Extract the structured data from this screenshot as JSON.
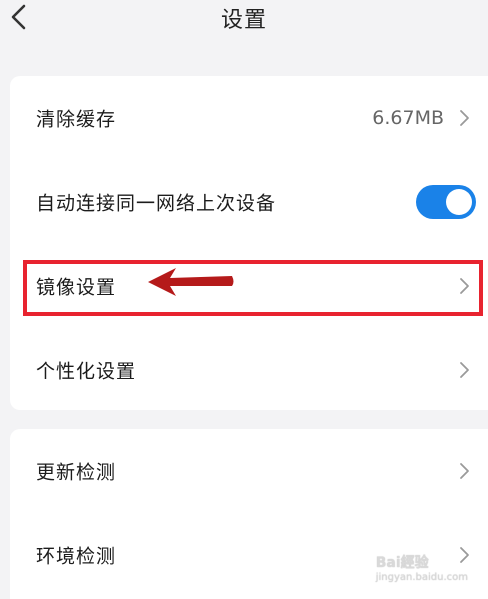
{
  "header": {
    "title": "设置"
  },
  "settings_group_1": {
    "items": [
      {
        "label": "清除缓存",
        "value": "6.67MB"
      },
      {
        "label": "自动连接同一网络上次设备",
        "toggle_on": true
      },
      {
        "label": "镜像设置"
      },
      {
        "label": "个性化设置"
      }
    ]
  },
  "settings_group_2": {
    "items": [
      {
        "label": "更新检测"
      },
      {
        "label": "环境检测"
      }
    ]
  },
  "annotation": {
    "highlight_color": "#e8232f",
    "arrow_color": "#b51a1a"
  },
  "watermark": {
    "text": "Bai經验",
    "sub": "jingyan.baidu.com"
  },
  "colors": {
    "accent": "#1a82e8",
    "background": "#f3f3f5",
    "card": "#ffffff"
  }
}
